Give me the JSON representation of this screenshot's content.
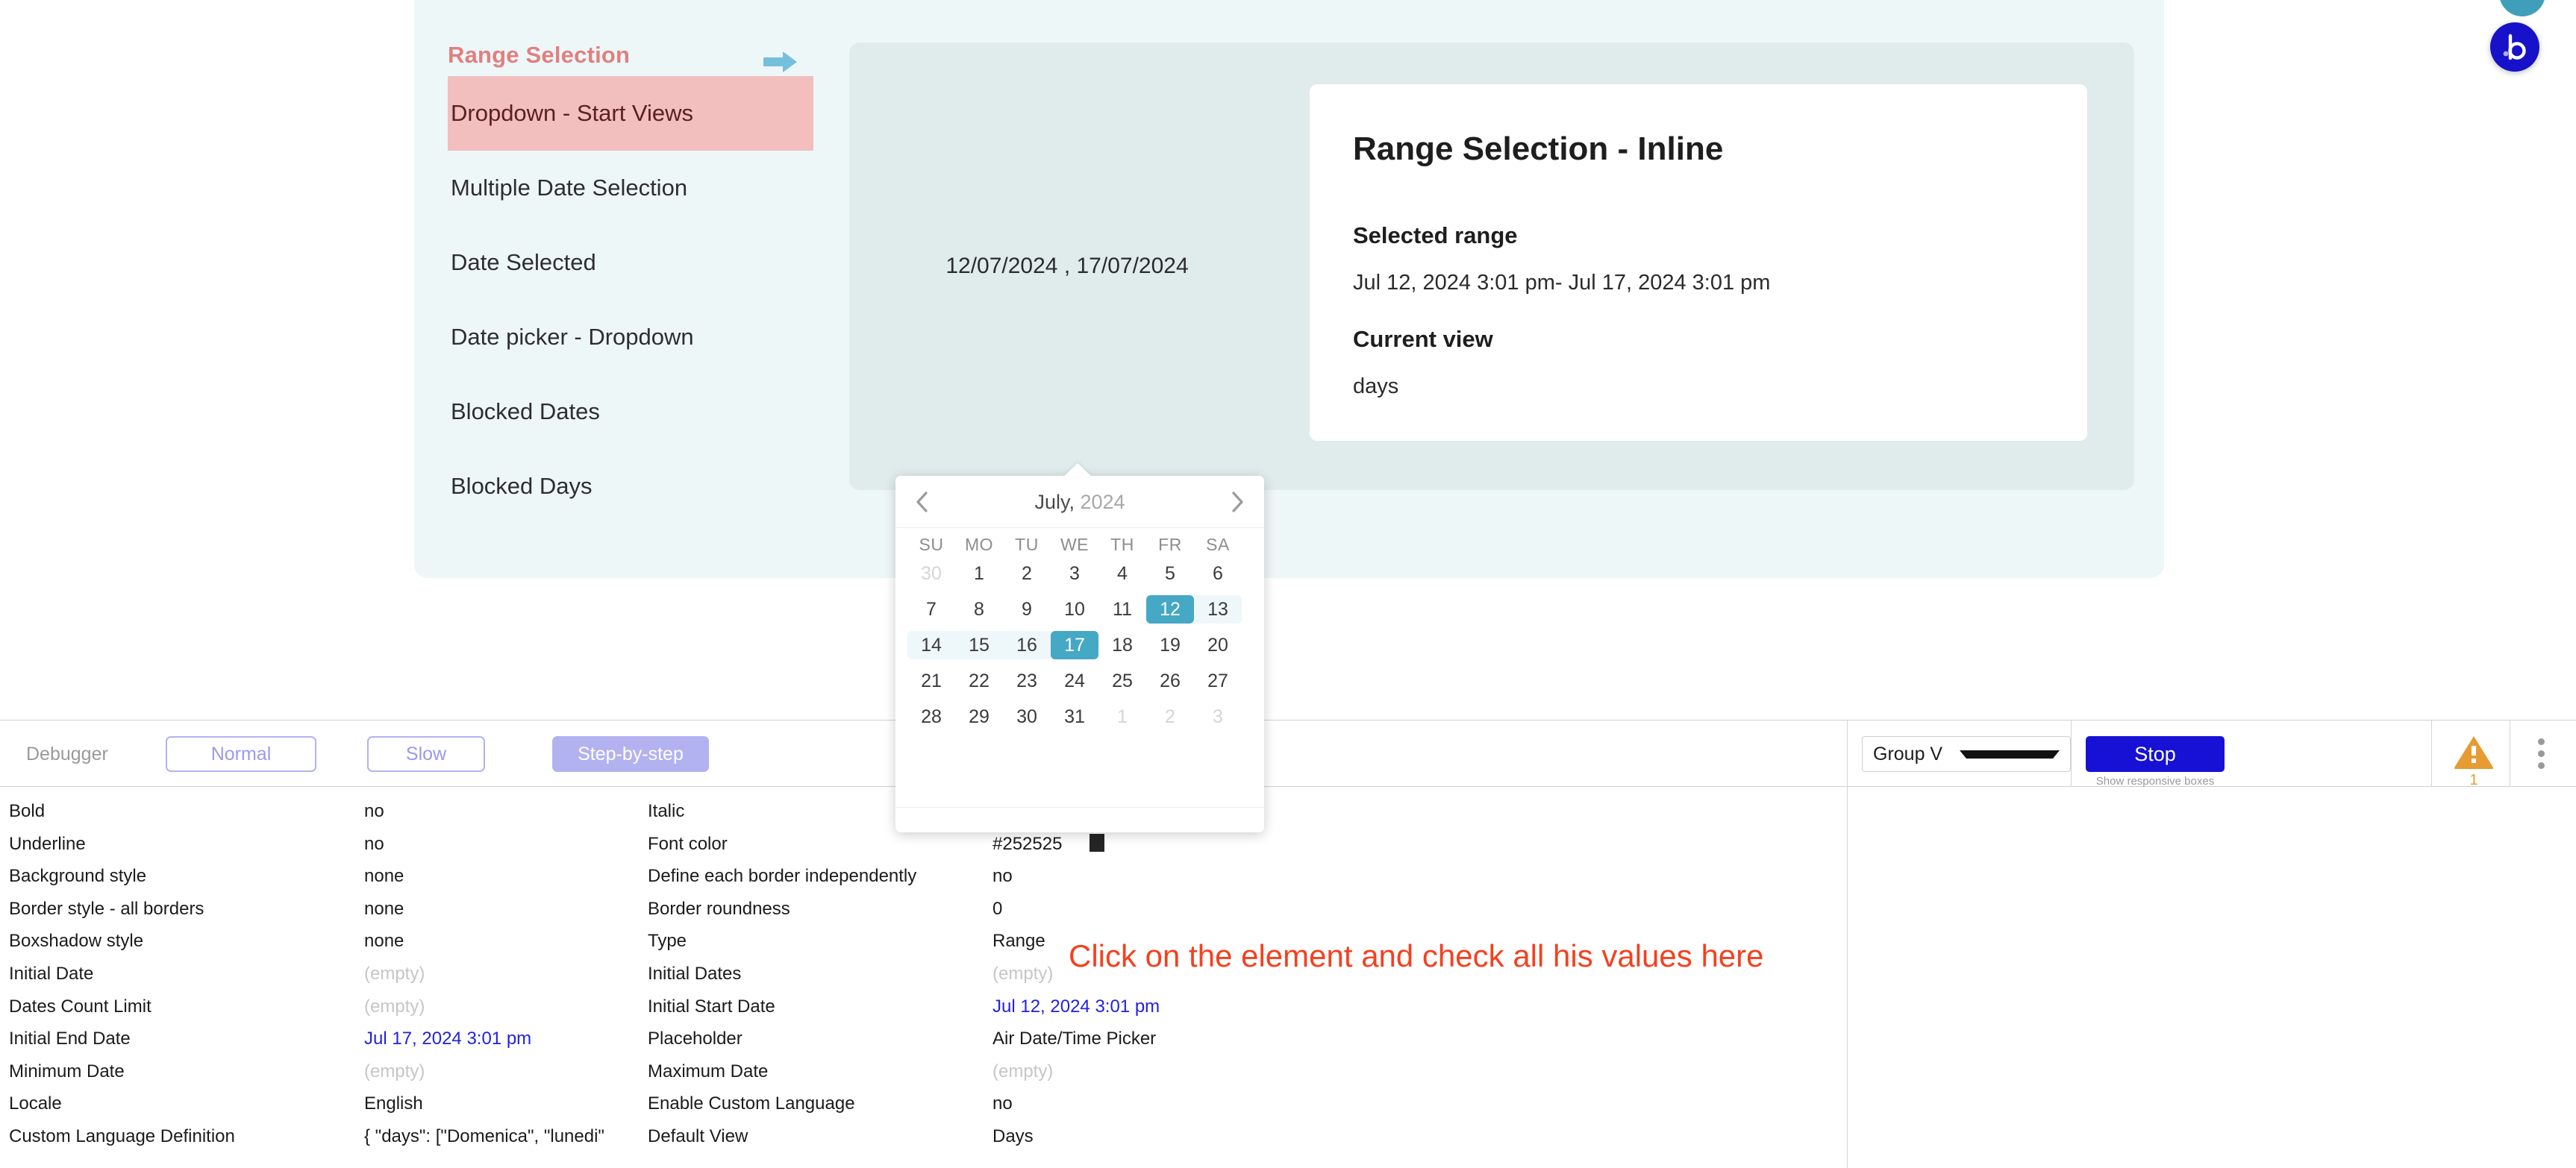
{
  "nav": {
    "header": "Range Selection",
    "items": [
      {
        "label": "Dropdown - Start Views",
        "active": true
      },
      {
        "label": "Multiple Date Selection",
        "active": false
      },
      {
        "label": "Date Selected",
        "active": false
      },
      {
        "label": "Date picker - Dropdown",
        "active": false
      },
      {
        "label": "Blocked Dates",
        "active": false
      },
      {
        "label": "Blocked Days",
        "active": false
      }
    ]
  },
  "preview": {
    "date_input_value": "12/07/2024 , 17/07/2024",
    "card": {
      "title": "Range Selection - Inline",
      "selected_range_label": "Selected range",
      "selected_range_value": "Jul 12, 2024 3:01 pm- Jul 17, 2024 3:01 pm",
      "current_view_label": "Current view",
      "current_view_value": "days"
    }
  },
  "calendar": {
    "month": "July,",
    "year": "2024",
    "prev_label": "previous month",
    "next_label": "next month",
    "weekdays": [
      "SU",
      "MO",
      "TU",
      "WE",
      "TH",
      "FR",
      "SA"
    ],
    "weeks": [
      [
        {
          "d": "30",
          "s": "dim"
        },
        {
          "d": "1",
          "s": ""
        },
        {
          "d": "2",
          "s": ""
        },
        {
          "d": "3",
          "s": ""
        },
        {
          "d": "4",
          "s": ""
        },
        {
          "d": "5",
          "s": ""
        },
        {
          "d": "6",
          "s": ""
        }
      ],
      [
        {
          "d": "7",
          "s": ""
        },
        {
          "d": "8",
          "s": ""
        },
        {
          "d": "9",
          "s": ""
        },
        {
          "d": "10",
          "s": ""
        },
        {
          "d": "11",
          "s": ""
        },
        {
          "d": "12",
          "s": "sel"
        },
        {
          "d": "13",
          "s": "inrange-end"
        }
      ],
      [
        {
          "d": "14",
          "s": "inrange-start"
        },
        {
          "d": "15",
          "s": "inrange"
        },
        {
          "d": "16",
          "s": "inrange"
        },
        {
          "d": "17",
          "s": "sel"
        },
        {
          "d": "18",
          "s": ""
        },
        {
          "d": "19",
          "s": ""
        },
        {
          "d": "20",
          "s": ""
        }
      ],
      [
        {
          "d": "21",
          "s": ""
        },
        {
          "d": "22",
          "s": ""
        },
        {
          "d": "23",
          "s": ""
        },
        {
          "d": "24",
          "s": ""
        },
        {
          "d": "25",
          "s": ""
        },
        {
          "d": "26",
          "s": ""
        },
        {
          "d": "27",
          "s": ""
        }
      ],
      [
        {
          "d": "28",
          "s": ""
        },
        {
          "d": "29",
          "s": ""
        },
        {
          "d": "30",
          "s": ""
        },
        {
          "d": "31",
          "s": ""
        },
        {
          "d": "1",
          "s": "dim"
        },
        {
          "d": "2",
          "s": "dim"
        },
        {
          "d": "3",
          "s": "dim"
        }
      ]
    ]
  },
  "debugger": {
    "label": "Debugger",
    "normal": "Normal",
    "slow": "Slow",
    "step": "Step-by-step",
    "group_value": "Group V",
    "stop": "Stop",
    "responsive_note": "Show responsive boxes",
    "warning_count": "1"
  },
  "properties": {
    "left": [
      {
        "key": "Bold",
        "value": "no",
        "style": ""
      },
      {
        "key": "Underline",
        "value": "no",
        "style": ""
      },
      {
        "key": "Background style",
        "value": "none",
        "style": ""
      },
      {
        "key": "Border style - all borders",
        "value": "none",
        "style": ""
      },
      {
        "key": "Boxshadow style",
        "value": "none",
        "style": ""
      },
      {
        "key": "Initial Date",
        "value": "(empty)",
        "style": "empty"
      },
      {
        "key": "Dates Count Limit",
        "value": "(empty)",
        "style": "empty"
      },
      {
        "key": "Initial End Date",
        "value": "Jul 17, 2024 3:01 pm",
        "style": "link"
      },
      {
        "key": "Minimum Date",
        "value": "(empty)",
        "style": "empty"
      },
      {
        "key": "Locale",
        "value": "English",
        "style": ""
      },
      {
        "key": "Custom Language Definition",
        "value": "{ \"days\": [\"Domenica\", \"lunedi\"",
        "style": ""
      }
    ],
    "right": [
      {
        "key": "Italic",
        "value": "",
        "style": ""
      },
      {
        "key": "Font color",
        "value": "#252525",
        "style": "swatch"
      },
      {
        "key": "Define each border independently",
        "value": "no",
        "style": ""
      },
      {
        "key": "Border roundness",
        "value": "0",
        "style": ""
      },
      {
        "key": "Type",
        "value": "Range",
        "style": ""
      },
      {
        "key": "Initial Dates",
        "value": "(empty)",
        "style": "empty"
      },
      {
        "key": "Initial Start Date",
        "value": "Jul 12, 2024 3:01 pm",
        "style": "link"
      },
      {
        "key": "Placeholder",
        "value": "Air Date/Time Picker",
        "style": ""
      },
      {
        "key": "Maximum Date",
        "value": "(empty)",
        "style": "empty"
      },
      {
        "key": "Enable Custom Language",
        "value": "no",
        "style": ""
      },
      {
        "key": "Default View",
        "value": "Days",
        "style": ""
      }
    ]
  },
  "annotation": "Click on the element and check all his values here",
  "colors": {
    "accent_teal": "#45a8c4",
    "panel_bg": "#eef7f8",
    "inner_panel_bg": "#e0ecec",
    "nav_header": "#e08080",
    "nav_active_bg": "#f2bebe",
    "debug_purple": "#b3b2f0",
    "stop_blue": "#1711d6",
    "warn_orange": "#e79b33",
    "annotation_red": "#f4411f"
  }
}
